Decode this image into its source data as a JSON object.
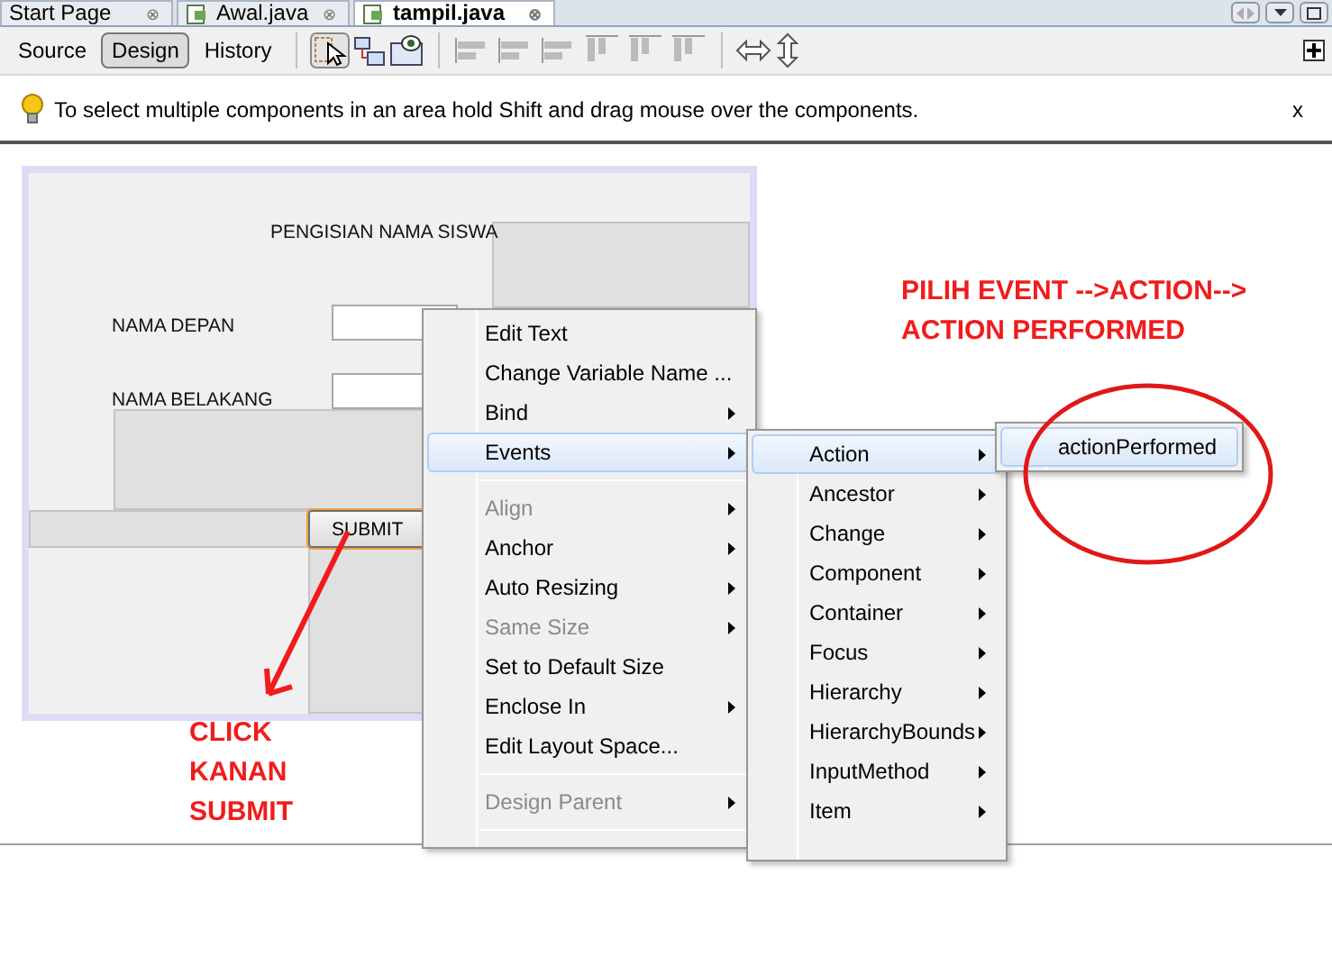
{
  "editor_tabs": [
    {
      "label": "Start Page",
      "kind": "page",
      "selected": false,
      "close": "⊗"
    },
    {
      "label": "Awal.java",
      "kind": "java",
      "selected": false,
      "close": "⊗"
    },
    {
      "label": "tampil.java",
      "kind": "java",
      "selected": true,
      "close": "⊗"
    }
  ],
  "view_tabs": [
    {
      "label": "Source",
      "selected": false
    },
    {
      "label": "Design",
      "selected": true
    },
    {
      "label": "History",
      "selected": false
    }
  ],
  "hint": {
    "text": "To select multiple components in an area hold Shift and drag mouse over the components.",
    "close": "x"
  },
  "form": {
    "title": "PENGISIAN NAMA SISWA",
    "first_name_label": "NAMA DEPAN",
    "last_name_label": "NAMA BELAKANG",
    "button": "SUBMIT"
  },
  "context_menu": [
    {
      "kind": "item",
      "label": "Edit Text",
      "disabled": false,
      "submenu": false,
      "selected": false
    },
    {
      "kind": "item",
      "label": "Change Variable Name ...",
      "disabled": false,
      "submenu": false,
      "selected": false
    },
    {
      "kind": "item",
      "label": "Bind",
      "disabled": false,
      "submenu": true,
      "selected": false
    },
    {
      "kind": "item",
      "label": "Events",
      "disabled": false,
      "submenu": true,
      "selected": true
    },
    {
      "kind": "separator"
    },
    {
      "kind": "item",
      "label": "Align",
      "disabled": true,
      "submenu": true,
      "selected": false
    },
    {
      "kind": "item",
      "label": "Anchor",
      "disabled": false,
      "submenu": true,
      "selected": false
    },
    {
      "kind": "item",
      "label": "Auto Resizing",
      "disabled": false,
      "submenu": true,
      "selected": false
    },
    {
      "kind": "item",
      "label": "Same Size",
      "disabled": true,
      "submenu": true,
      "selected": false
    },
    {
      "kind": "item",
      "label": "Set to Default Size",
      "disabled": false,
      "submenu": false,
      "selected": false
    },
    {
      "kind": "item",
      "label": "Enclose In",
      "disabled": false,
      "submenu": true,
      "selected": false
    },
    {
      "kind": "item",
      "label": "Edit Layout Space...",
      "disabled": false,
      "submenu": false,
      "selected": false
    },
    {
      "kind": "separator"
    },
    {
      "kind": "item",
      "label": "Design Parent",
      "disabled": true,
      "submenu": true,
      "selected": false
    },
    {
      "kind": "separator"
    }
  ],
  "events_menu": [
    {
      "label": "Action",
      "selected": true
    },
    {
      "label": "Ancestor",
      "selected": false
    },
    {
      "label": "Change",
      "selected": false
    },
    {
      "label": "Component",
      "selected": false
    },
    {
      "label": "Container",
      "selected": false
    },
    {
      "label": "Focus",
      "selected": false
    },
    {
      "label": "Hierarchy",
      "selected": false
    },
    {
      "label": "HierarchyBounds",
      "selected": false
    },
    {
      "label": "InputMethod",
      "selected": false
    },
    {
      "label": "Item",
      "selected": false
    }
  ],
  "action_menu": [
    {
      "label": "actionPerformed",
      "selected": true
    }
  ],
  "annotations": {
    "instruction_lines": [
      "PILIH EVENT -->ACTION-->",
      "ACTION PERFORMED"
    ],
    "click_lines": [
      "CLICK",
      "KANAN",
      "SUBMIT"
    ]
  }
}
